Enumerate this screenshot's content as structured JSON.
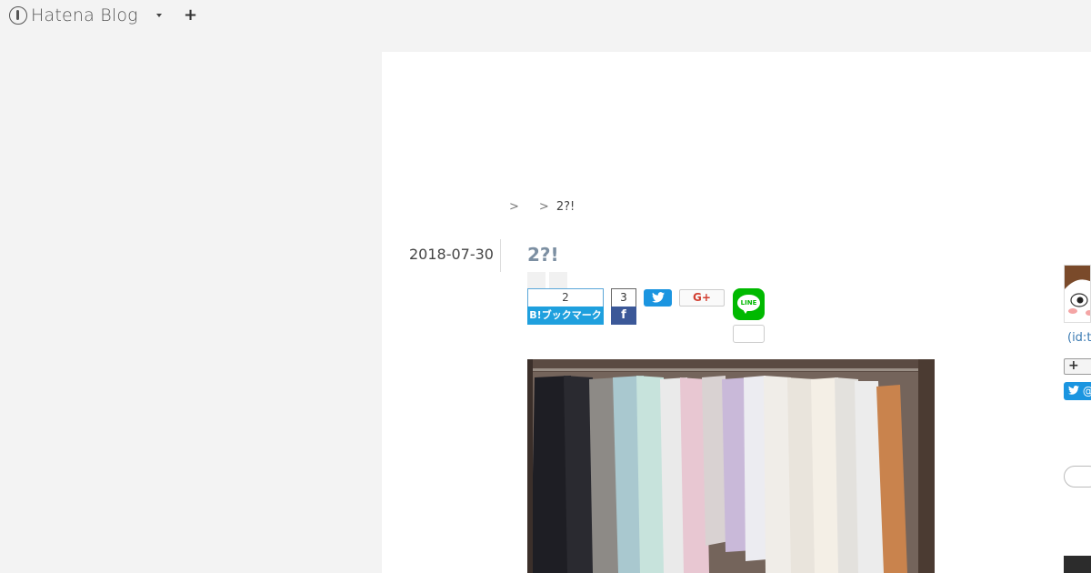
{
  "topbar": {
    "brand_text": "Hatena Blog",
    "add_label": "+"
  },
  "breadcrumb": {
    "sep1": ">",
    "sep2": ">",
    "current": "2?!"
  },
  "entry": {
    "date": "2018-07-30",
    "title": "2?!"
  },
  "share": {
    "hatena_count": "2",
    "hatena_label": "B!ブックマーク",
    "facebook_count": "3",
    "facebook_glyph": "f",
    "google_label": "G+",
    "line_label": "LINE"
  },
  "sidebar": {
    "profile_id": "(id:t",
    "follow_label": "+",
    "twitter_follow_label": "@"
  },
  "colors": {
    "hatena_blue": "#1fa0de",
    "facebook_blue": "#3b5898",
    "twitter_blue": "#1b95e0",
    "google_red": "#d23f31",
    "line_green": "#00b900",
    "title_color": "#7c8fa2"
  }
}
